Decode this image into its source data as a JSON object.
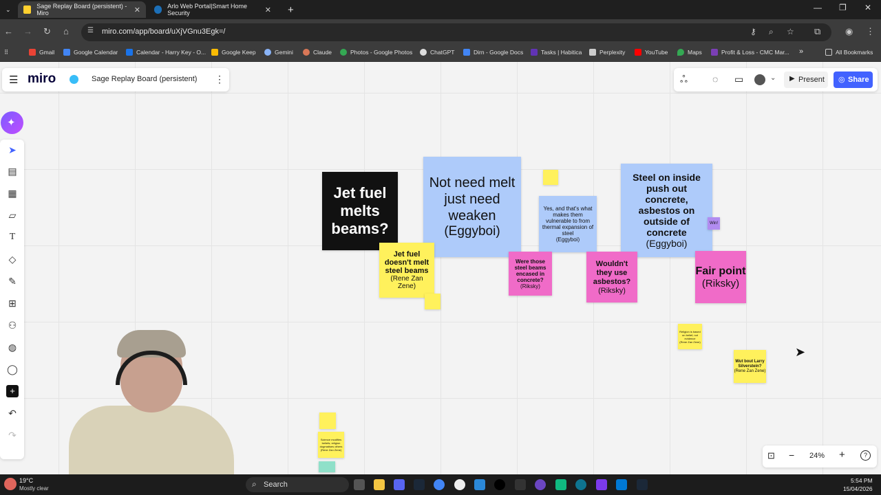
{
  "browser": {
    "tabs": [
      {
        "title": "Sage Replay Board (persistent) - Miro",
        "active": true
      },
      {
        "title": "Arlo Web Portal|Smart Home Security",
        "active": false
      }
    ],
    "url": "miro.com/app/board/uXjVGnu3Egk=/",
    "bookmarks": [
      "Gmail",
      "Google Calendar",
      "Calendar - Harry Key - O...",
      "Google Keep",
      "Gemini",
      "Claude",
      "Photos - Google Photos",
      "ChatGPT",
      "Dirn - Google Docs",
      "Tasks | Habitica",
      "Perplexity",
      "YouTube",
      "Maps",
      "Profit & Loss - CMC Mar..."
    ],
    "all_bookmarks": "All Bookmarks"
  },
  "miro": {
    "logo": "miro",
    "board_name": "Sage Replay Board (persistent)",
    "present_label": "Present",
    "share_label": "Share",
    "zoom": "24%"
  },
  "notes": {
    "jet_fuel": "Jet fuel melts beams?",
    "not_need": "Not need melt just need weaken",
    "not_need_author": "(Eggyboi)",
    "yes_thats": "Yes, and that's what makes them vulnerable to from thermal expansion of steel",
    "yes_thats_author": "(Eggyboi)",
    "steel_inside": "Steel on inside push out concrete, asbestos on outside of concrete",
    "steel_inside_author": "(Eggyboi)",
    "win": "Win!",
    "jet_doesnt": "Jet fuel doesn't melt steel beams",
    "jet_doesnt_author": "(Rene Zan Zene)",
    "were_those": "Were those steel beams encased in concrete?",
    "were_those_author": "(Riksky)",
    "wouldnt": "Wouldn't they use asbestos?",
    "wouldnt_author": "(Riksky)",
    "fair_point": "Fair point",
    "fair_point_author": "(Riksky)",
    "religion": "Religion is based on belief, not evidence",
    "religion_author": "(Rene Zan Zene)",
    "larry": "Wut bout Larry Silverstein?",
    "larry_author": "(Rene Zan Zene)",
    "science": "Science modifies beliefs; religion dogmatises others",
    "science_author": "(Rene Zan Zene)"
  },
  "taskbar": {
    "weather_temp": "19°C",
    "weather_desc": "Mostly clear",
    "search_label": "Search",
    "time": "5:54 PM",
    "date": "15/04/2026"
  },
  "colors": {
    "miro_blue": "#4262ff",
    "note_yellow": "#fff15c",
    "note_blue": "#aecbfa",
    "note_pink": "#f06bc8"
  }
}
